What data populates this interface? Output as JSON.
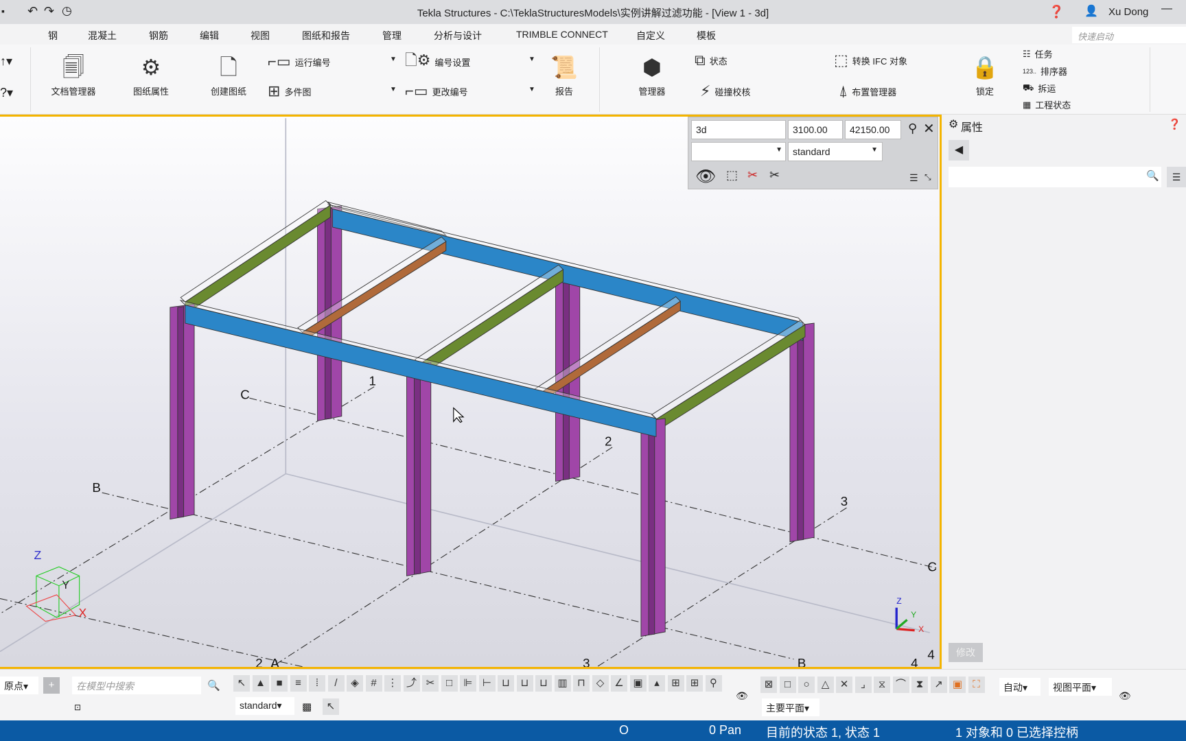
{
  "window": {
    "title": "Tekla Structures - C:\\TeklaStructuresModels\\实例讲解过滤功能 - [View 1 - 3d]",
    "user": "Xu Dong"
  },
  "menu": {
    "tabs": [
      "钢",
      "混凝土",
      "钢筋",
      "编辑",
      "视图",
      "图纸和报告",
      "管理",
      "分析与设计",
      "TRIMBLE CONNECT",
      "自定义",
      "模板"
    ],
    "active": "图纸和报告",
    "quick_launch_placeholder": "快速启动"
  },
  "ribbon": {
    "big": [
      "文档管理器",
      "图纸属性",
      "创建图纸",
      "报告",
      "管理器",
      "锁定"
    ],
    "small": [
      "运行编号",
      "多件图",
      "编号设置",
      "更改编号",
      "状态",
      "碰撞校核",
      "转换 IFC 对象",
      "布置管理器",
      "任务",
      "排序器",
      "拆运",
      "工程状态"
    ]
  },
  "view_controls": {
    "view_name": "3d",
    "depth_up": "3100.00",
    "depth_down": "42150.00",
    "filter": "",
    "representation": "standard"
  },
  "properties": {
    "title": "属性",
    "search_placeholder": "",
    "modify_button": "修改"
  },
  "grid_labels": [
    "C",
    "1",
    "B",
    "2",
    "3",
    "C",
    "2",
    "A",
    "3",
    "B",
    "4",
    "4"
  ],
  "axes": {
    "z": "Z",
    "y": "Y",
    "x": "X"
  },
  "bottom_toolbar": {
    "origin_dropdown": "原点",
    "search_placeholder": "在模型中搜索",
    "filter_dropdown": "standard",
    "snap_auto": "自动",
    "snap_plane": "视图平面",
    "work_plane": "主要平面"
  },
  "status": {
    "coord": "O",
    "pan": "0 Pan",
    "state": "目前的状态 1, 状态 1",
    "selection": "1 对象和 0 已选择控柄"
  },
  "colors": {
    "column": "#a046a8",
    "main_beam": "#2b86c8",
    "side_beam": "#6a8a30",
    "secondary_beam": "#b06a3a",
    "status_bar": "#0b5aa4",
    "viewport_border": "#f4b400"
  }
}
